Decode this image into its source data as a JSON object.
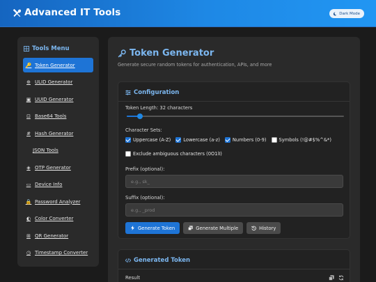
{
  "header": {
    "app_title": "Advanced IT Tools",
    "dark_mode_label": "Dark Mode",
    "logo_icon": "tools-icon",
    "background": "#1e88e5"
  },
  "sidebar": {
    "title": "Tools Menu",
    "items": [
      {
        "label": "Token Generator",
        "icon": "key-icon",
        "active": true
      },
      {
        "label": "ULID Generator",
        "icon": "ulid-icon",
        "active": false
      },
      {
        "label": "UUID Generator",
        "icon": "id-card-icon",
        "active": false
      },
      {
        "label": "Base64 Tools",
        "icon": "code-icon",
        "active": false
      },
      {
        "label": "Hash Generator",
        "icon": "hash-icon",
        "active": false
      },
      {
        "label": "JSON Tools",
        "icon": "",
        "active": false
      },
      {
        "label": "OTP Generator",
        "icon": "shield-icon",
        "active": false
      },
      {
        "label": "Device Info",
        "icon": "laptop-icon",
        "active": false
      },
      {
        "label": "Password Analyzer",
        "icon": "lock-icon",
        "active": false
      },
      {
        "label": "Color Converter",
        "icon": "palette-icon",
        "active": false
      },
      {
        "label": "QR Generator",
        "icon": "qr-icon",
        "active": false
      },
      {
        "label": "Timestamp Converter",
        "icon": "clock-icon",
        "active": false
      }
    ]
  },
  "main": {
    "title": "Token Generator",
    "subtitle": "Generate secure random tokens for authentication, APIs, and more",
    "config": {
      "title": "Configuration",
      "length_label": "Token Length: 32 characters",
      "length_value": 32,
      "length_fraction": 0.06,
      "charsets_label": "Character Sets:",
      "charsets": [
        {
          "label": "Uppercase (A-Z)",
          "checked": true
        },
        {
          "label": "Lowercase (a-z)",
          "checked": true
        },
        {
          "label": "Numbers (0-9)",
          "checked": true
        },
        {
          "label": "Symbols (!@#$%^&*)",
          "checked": false
        }
      ],
      "exclude_label": "Exclude ambiguous characters (0O1lI)",
      "exclude_checked": false,
      "prefix_label": "Prefix (optional):",
      "prefix_placeholder": "e.g., sk_",
      "suffix_label": "Suffix (optional):",
      "suffix_placeholder": "e.g., _prod",
      "buttons": {
        "generate": "Generate Token",
        "generate_multiple": "Generate Multiple",
        "history": "History"
      }
    },
    "generated": {
      "title": "Generated Token",
      "result_label": "Result"
    }
  },
  "colors": {
    "accent": "#1e74d6",
    "heading": "#7cb7f0",
    "background": "#1b1b1b",
    "panel": "#2a2a2a"
  }
}
